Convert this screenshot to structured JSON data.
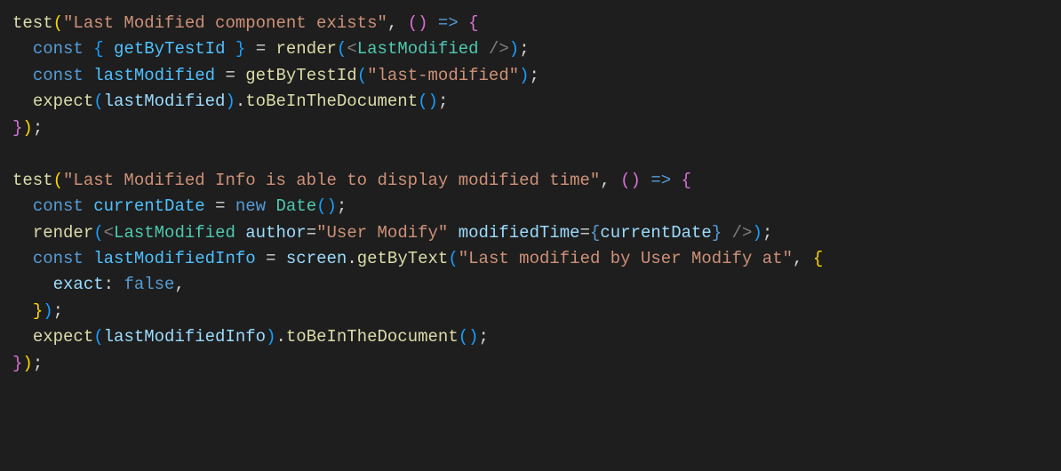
{
  "code": {
    "test1": {
      "fn_test": "test",
      "str_name": "\"Last Modified component exists\"",
      "arrow_l": "(",
      "arrow_r": ")",
      "arrow": "=>",
      "brace_l": "{",
      "line1": {
        "kw_const": "const",
        "destr_l": "{",
        "var_getByTestId": "getByTestId",
        "destr_r": "}",
        "eq": "=",
        "fn_render": "render",
        "paren_l": "(",
        "jsx_open": "<",
        "jsx_comp": "LastModified",
        "jsx_close": "/>",
        "paren_r": ")",
        "semi": ";"
      },
      "line2": {
        "kw_const": "const",
        "var_lastModified": "lastModified",
        "eq": "=",
        "fn_getByTestId": "getByTestId",
        "paren_l": "(",
        "str_arg": "\"last-modified\"",
        "paren_r": ")",
        "semi": ";"
      },
      "line3": {
        "fn_expect": "expect",
        "paren_l1": "(",
        "var_lastModified": "lastModified",
        "paren_r1": ")",
        "dot": ".",
        "fn_matcher": "toBeInTheDocument",
        "paren_l2": "(",
        "paren_r2": ")",
        "semi": ";"
      },
      "brace_r": "}",
      "paren_r": ")",
      "semi": ";"
    },
    "test2": {
      "fn_test": "test",
      "str_name": "\"Last Modified Info is able to display modified time\"",
      "arrow_l": "(",
      "arrow_r": ")",
      "arrow": "=>",
      "brace_l": "{",
      "line1": {
        "kw_const": "const",
        "var_currentDate": "currentDate",
        "eq": "=",
        "kw_new": "new",
        "type_Date": "Date",
        "paren_l": "(",
        "paren_r": ")",
        "semi": ";"
      },
      "line2": {
        "fn_render": "render",
        "paren_l": "(",
        "jsx_open": "<",
        "jsx_comp": "LastModified",
        "attr_author": "author",
        "eq1": "=",
        "str_author": "\"User Modify\"",
        "attr_modifiedTime": "modifiedTime",
        "eq2": "=",
        "brace_l": "{",
        "var_currentDate": "currentDate",
        "brace_r": "}",
        "jsx_close": "/>",
        "paren_r": ")",
        "semi": ";"
      },
      "line3": {
        "kw_const": "const",
        "var_lastModifiedInfo": "lastModifiedInfo",
        "eq": "=",
        "obj_screen": "screen",
        "dot": ".",
        "fn_getByText": "getByText",
        "paren_l": "(",
        "str_arg": "\"Last modified by User Modify at\"",
        "comma": ",",
        "brace_l": "{"
      },
      "line4": {
        "prop_exact": "exact",
        "colon": ":",
        "val_false": "false",
        "comma": ","
      },
      "line5": {
        "brace_r": "}",
        "paren_r": ")",
        "semi": ";"
      },
      "line6": {
        "fn_expect": "expect",
        "paren_l1": "(",
        "var_lastModifiedInfo": "lastModifiedInfo",
        "paren_r1": ")",
        "dot": ".",
        "fn_matcher": "toBeInTheDocument",
        "paren_l2": "(",
        "paren_r2": ")",
        "semi": ";"
      },
      "brace_r": "}",
      "paren_r": ")",
      "semi": ";"
    }
  }
}
